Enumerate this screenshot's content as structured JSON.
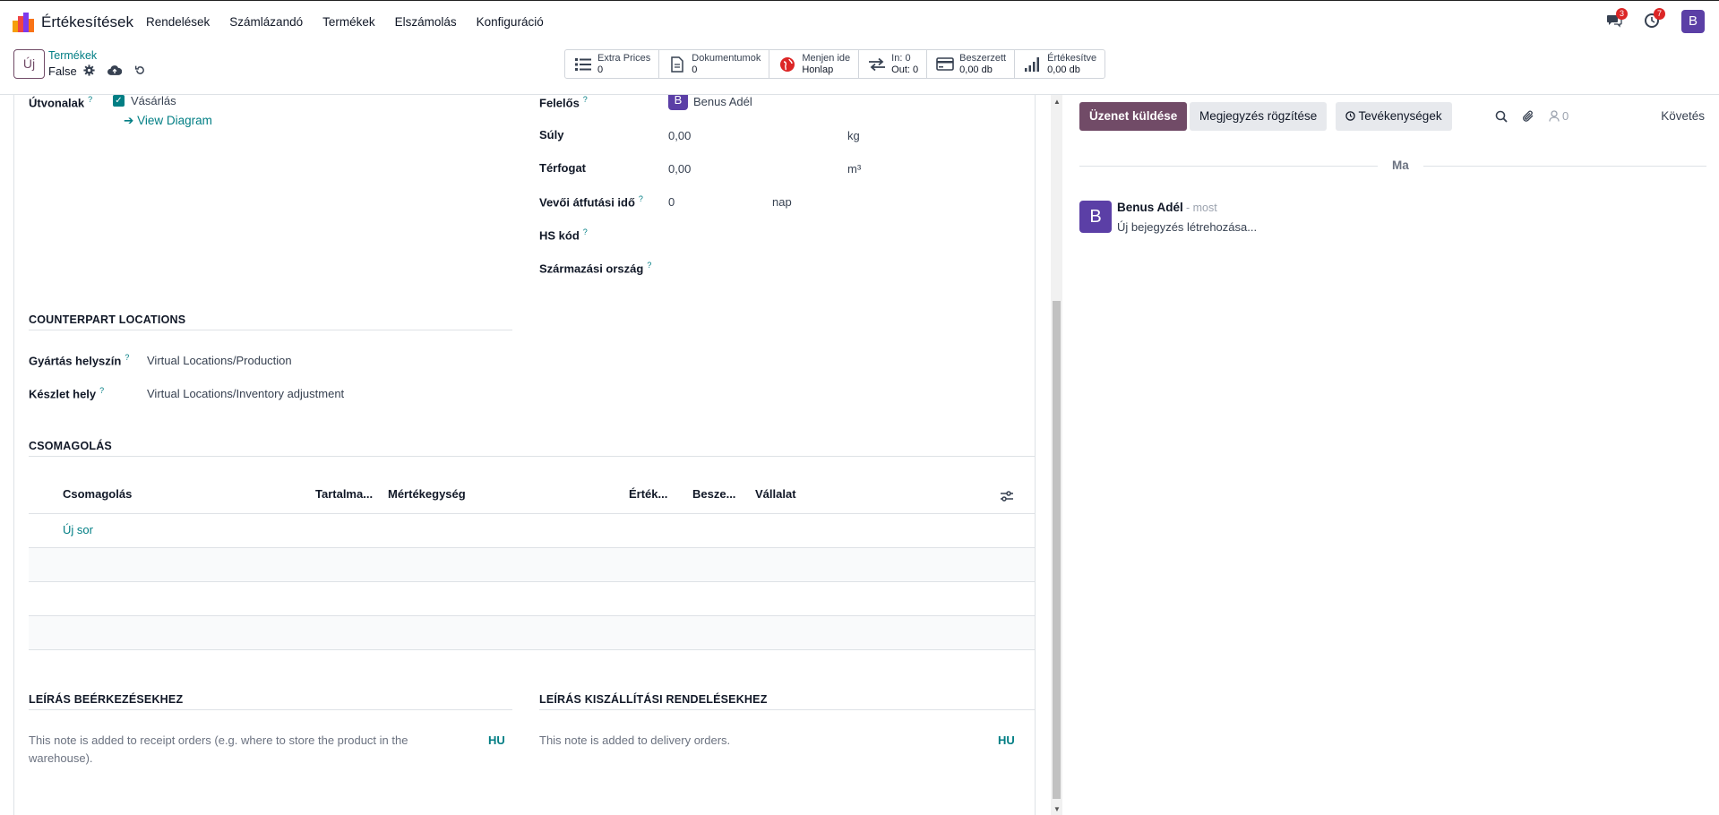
{
  "app": {
    "title": "Értékesítések",
    "menu": [
      "Rendelések",
      "Számlázandó",
      "Termékek",
      "Elszámolás",
      "Konfiguráció"
    ],
    "messages_badge": "3",
    "activities_badge": "7",
    "user_initial": "B"
  },
  "control": {
    "new_button": "Új",
    "breadcrumb_parent": "Termékek",
    "breadcrumb_current": "False",
    "stats": [
      {
        "title": "Extra Prices",
        "value": "0",
        "icon": "list-icon"
      },
      {
        "title": "Dokumentumok",
        "value": "0",
        "icon": "document-icon"
      },
      {
        "title": "Menjen ide",
        "value": "Honlap",
        "icon": "globe-icon"
      },
      {
        "title": "In: 0",
        "value": "Out: 0",
        "icon": "transfer-arrows-icon"
      },
      {
        "title": "Beszerzett",
        "value": "0,00 db",
        "icon": "credit-card-icon"
      },
      {
        "title": "Értékesítve",
        "value": "0,00 db",
        "icon": "signal-bars-icon"
      }
    ]
  },
  "form": {
    "routes_label": "Útvonalak",
    "routes_value": "Vásárlás",
    "view_diagram": "View Diagram",
    "responsible_label": "Felelős",
    "responsible_initial": "B",
    "responsible_value": "Benus Adél",
    "weight_label": "Súly",
    "weight_value": "0,00",
    "weight_unit": "kg",
    "volume_label": "Térfogat",
    "volume_value": "0,00",
    "volume_unit": "m³",
    "lead_label": "Vevői átfutási idő",
    "lead_value": "0",
    "lead_unit": "nap",
    "hs_label": "HS kód",
    "origin_label": "Származási ország",
    "counterpart_title": "Counterpart Locations",
    "production_label": "Gyártás helyszín",
    "production_value": "Virtual Locations/Production",
    "inventory_label": "Készlet hely",
    "inventory_value": "Virtual Locations/Inventory adjustment",
    "packaging_title": "Csomagolás",
    "table_headers": [
      "Csomagolás",
      "Tartalma...",
      "Mértékegység",
      "Érték...",
      "Besze...",
      "Vállalat"
    ],
    "add_line": "Új sor",
    "receipt_title": "Leírás beérkezésekhez",
    "receipt_note": "This note is added to receipt orders (e.g. where to store the product in the warehouse).",
    "delivery_title": "Leírás kiszállítási rendelésekhez",
    "delivery_note": "This note is added to delivery orders.",
    "lang_tag": "HU"
  },
  "chatter": {
    "send_message": "Üzenet küldése",
    "log_note": "Megjegyzés rögzítése",
    "activities": "Tevékenységek",
    "followers_count": "0",
    "follow": "Követés",
    "day_label": "Ma",
    "message": {
      "initial": "B",
      "author": "Benus Adél",
      "time": "- most",
      "body": "Új bejegyzés létrehozása..."
    }
  }
}
